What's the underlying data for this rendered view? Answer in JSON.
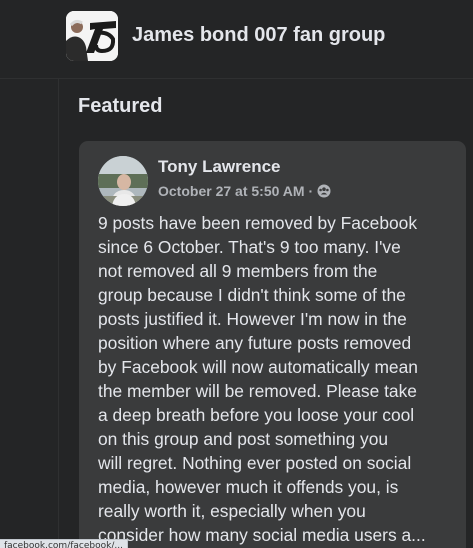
{
  "group": {
    "name": "James bond 007 fan group",
    "avatar_icon": "group-cover-thumbnail"
  },
  "featured": {
    "heading": "Featured"
  },
  "post": {
    "author": "Tony Lawrence",
    "timestamp": "October 27 at 5:50 AM",
    "separator": "·",
    "audience_icon": "group-members-icon",
    "body_lines": [
      "9 posts have been removed by Facebook",
      "since 6 October. That's 9 too many. I've",
      "not removed all 9 members from the",
      "group because I didn't think some of the",
      "posts justified it. However I'm now in the",
      "position where any future posts removed",
      "by Facebook will now automatically mean",
      "the member will be removed. Please take",
      "a deep breath before you loose your cool",
      "on this group and post something you",
      "will regret. Nothing ever posted on social",
      "media, however much it offends you, is",
      "really worth it, especially when you",
      "consider how many social media users a..."
    ]
  },
  "status_bar": {
    "url": "facebook.com/facebook/..."
  },
  "colors": {
    "page_bg": "#18191a",
    "surface": "#242526",
    "card": "#3a3b3c",
    "primary_text": "#e4e6eb",
    "secondary_text": "#b0b3b8"
  }
}
